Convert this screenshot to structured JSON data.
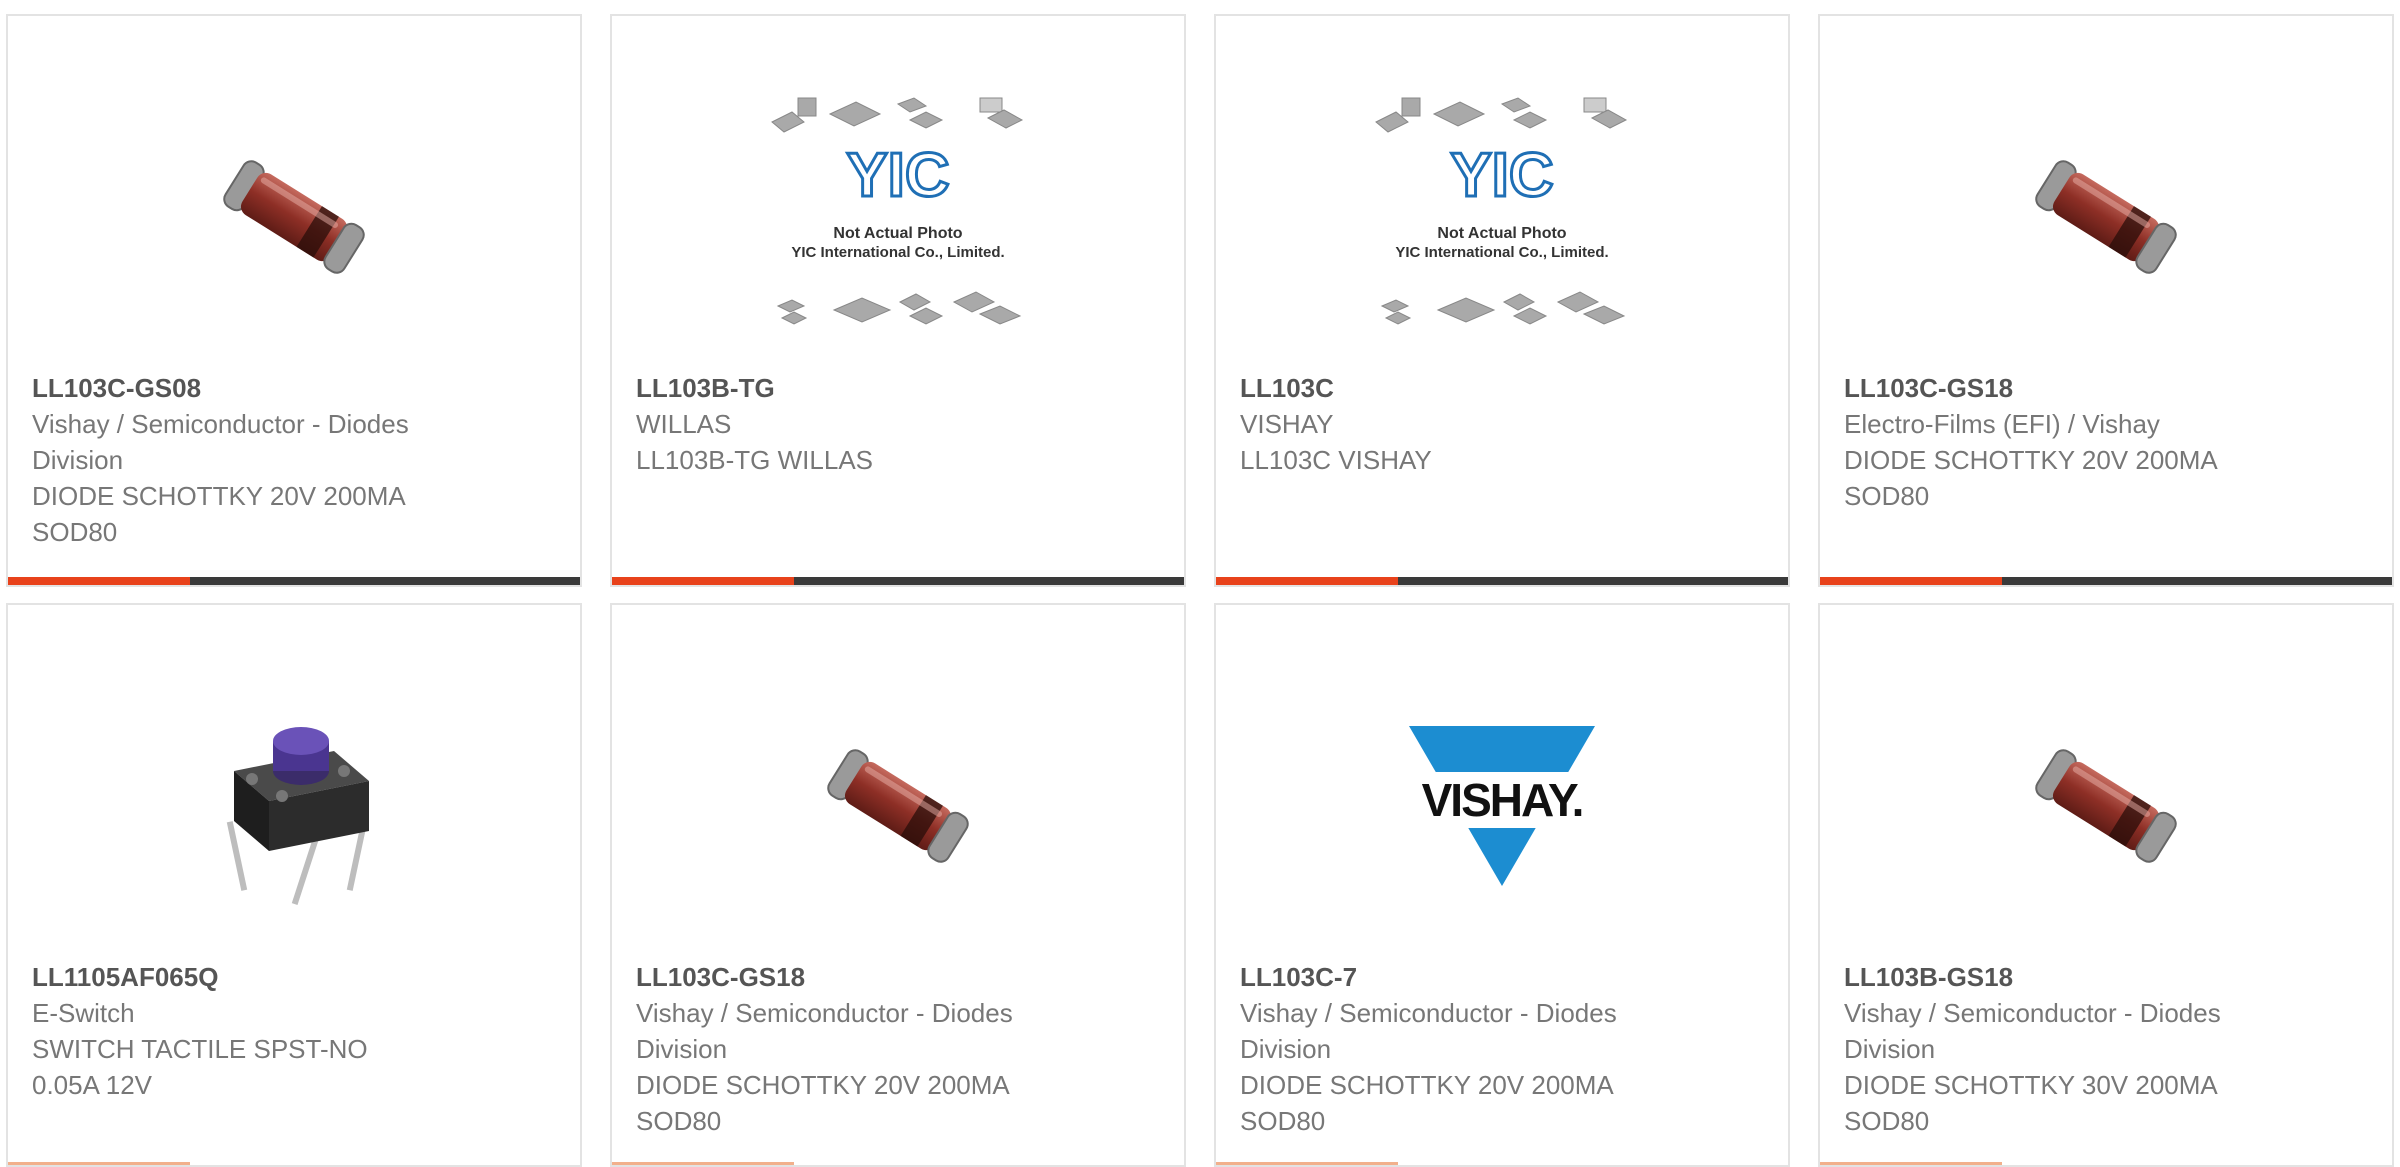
{
  "products": [
    {
      "part": "LL103C-GS08",
      "lines": [
        "Vishay / Semiconductor - Diodes",
        "Division",
        "DIODE SCHOTTKY 20V 200MA",
        "SOD80"
      ],
      "image": "diode-icon"
    },
    {
      "part": "LL103B-TG",
      "lines": [
        "WILLAS",
        "LL103B-TG WILLAS"
      ],
      "image": "placeholder-photo",
      "placeholder": {
        "brand": "YIC",
        "caption1": "Not Actual Photo",
        "caption2": "YIC International Co., Limited."
      }
    },
    {
      "part": "LL103C",
      "lines": [
        "VISHAY",
        "LL103C VISHAY"
      ],
      "image": "placeholder-photo",
      "placeholder": {
        "brand": "YIC",
        "caption1": "Not Actual Photo",
        "caption2": "YIC International Co., Limited."
      }
    },
    {
      "part": "LL103C-GS18",
      "lines": [
        "Electro-Films (EFI) / Vishay",
        "DIODE SCHOTTKY 20V 200MA",
        "SOD80"
      ],
      "image": "diode-icon"
    },
    {
      "part": "LL1105AF065Q",
      "lines": [
        "E-Switch",
        "SWITCH TACTILE SPST-NO",
        "0.05A 12V"
      ],
      "image": "tactile-switch-icon"
    },
    {
      "part": "LL103C-GS18",
      "lines": [
        "Vishay / Semiconductor - Diodes",
        "Division",
        "DIODE SCHOTTKY 20V 200MA",
        "SOD80"
      ],
      "image": "diode-icon"
    },
    {
      "part": "LL103C-7",
      "lines": [
        "Vishay / Semiconductor - Diodes",
        "Division",
        "DIODE SCHOTTKY 20V 200MA",
        "SOD80"
      ],
      "image": "vishay-logo",
      "logo_text": "VISHAY."
    },
    {
      "part": "LL103B-GS18",
      "lines": [
        "Vishay / Semiconductor - Diodes",
        "Division",
        "DIODE SCHOTTKY 30V 200MA",
        "SOD80"
      ],
      "image": "diode-icon"
    }
  ],
  "colors": {
    "accent": "#e8421b",
    "bar": "#3a3a3a",
    "text": "#777777",
    "title": "#555555",
    "vishay_blue": "#1c8dd1"
  }
}
